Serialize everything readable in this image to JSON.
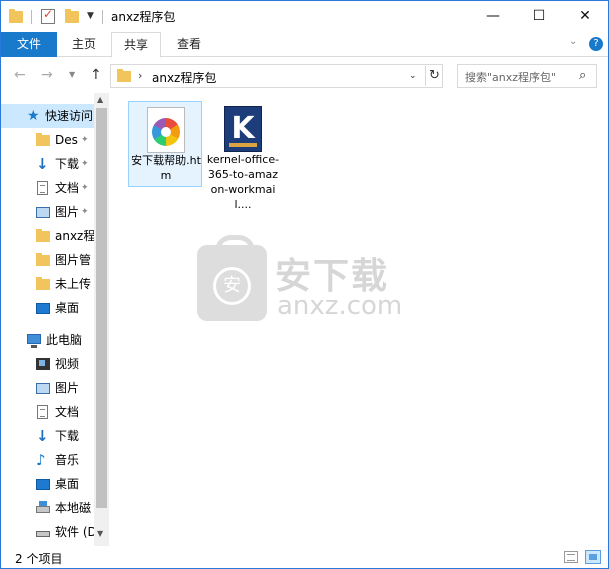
{
  "window": {
    "title": "anxz程序包",
    "minimize": "—",
    "maximize": "☐",
    "close": "✕"
  },
  "ribbon": {
    "tabs": [
      "文件",
      "主页",
      "共享",
      "查看"
    ],
    "active_tab": "共享",
    "file_tab_color": "#1979ca"
  },
  "navigation": {
    "back": "←",
    "forward": "→",
    "up": "↑",
    "address": "anxz程序包",
    "search_placeholder": "搜索\"anxz程序包\""
  },
  "sidebar": {
    "items": [
      {
        "label": "快速访问",
        "icon": "star-icon"
      },
      {
        "label": "Des",
        "icon": "folder-icon",
        "pinned": true
      },
      {
        "label": "下载",
        "icon": "download-icon",
        "pinned": true
      },
      {
        "label": "文档",
        "icon": "document-icon",
        "pinned": true
      },
      {
        "label": "图片",
        "icon": "picture-icon",
        "pinned": true
      },
      {
        "label": "anxz程",
        "icon": "folder-icon"
      },
      {
        "label": "图片管",
        "icon": "folder-icon"
      },
      {
        "label": "未上传",
        "icon": "folder-icon"
      },
      {
        "label": "桌面",
        "icon": "desktop-icon"
      },
      {
        "label": "此电脑",
        "icon": "computer-icon"
      },
      {
        "label": "视频",
        "icon": "video-icon"
      },
      {
        "label": "图片",
        "icon": "picture-icon"
      },
      {
        "label": "文档",
        "icon": "document-icon"
      },
      {
        "label": "下载",
        "icon": "download-icon"
      },
      {
        "label": "音乐",
        "icon": "music-icon"
      },
      {
        "label": "桌面",
        "icon": "desktop-icon"
      },
      {
        "label": "本地磁",
        "icon": "local-disk-icon"
      },
      {
        "label": "软件 (D",
        "icon": "drive-icon"
      }
    ]
  },
  "files": [
    {
      "name": "安下载帮助.htm",
      "icon": "htm-file-icon",
      "selected": true
    },
    {
      "name": "kernel-office-365-to-amazon-workmail....",
      "icon": "kernel-app-icon",
      "selected": false
    }
  ],
  "watermark": {
    "cn": "安下载",
    "en": "anxz.com",
    "badge": "安"
  },
  "status": {
    "item_count": "2 个项目"
  }
}
